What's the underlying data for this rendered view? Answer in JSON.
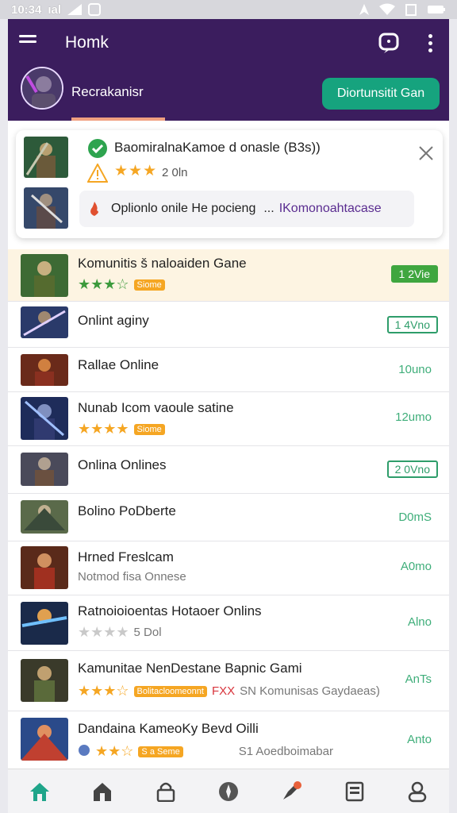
{
  "status_bar": {
    "time": "10:34",
    "carrier": "ıal"
  },
  "app_bar": {
    "title": "Homk",
    "profile_name": "Recrakanisr",
    "primary_button": "Diortunsitit Gan"
  },
  "notification": {
    "title": "BaomiralnaKamoe d onasle (B3s))",
    "meta": "2 0ln",
    "message": "Oplionlo onile He pocieng",
    "ellipsis": "...",
    "link": "IKomonoahtacase"
  },
  "games": [
    {
      "title": "Komunitis š naloaiden Gane",
      "stars": "★★★☆",
      "tag": "Siome",
      "badge": "1 2Vie"
    },
    {
      "title": "Onlint aginy",
      "badge": "1 4Vno"
    },
    {
      "title": "Rallae Online",
      "badge": "10uno"
    },
    {
      "title": "Nunab Icom vaoule satine",
      "stars": "★★★★",
      "tag": "Siome",
      "badge": "12umo"
    },
    {
      "title": "Onlina Onlines",
      "badge": "2 0Vno"
    },
    {
      "title": "Bolino PoDberte",
      "badge": "D0mS"
    },
    {
      "title": "Hrned Freslcam",
      "subtitle": "Notmod fisa Onnese",
      "badge": "A0mo"
    },
    {
      "title": "Ratnoioioentas Hotaoer Onlins",
      "stars": "★★★★",
      "meta": "5 Dol",
      "badge": "Alno"
    },
    {
      "title": "Kamunitae NenDestane Bapnic Gami",
      "stars": "★★★☆",
      "tag": "Bolitacloomeonnt",
      "fx": "FXX",
      "meta": "SN Komunisas Gaydaeas)",
      "badge": "AnTs"
    },
    {
      "title": "Dandaina KameoKy Bevd Oilli",
      "stars": "★★☆",
      "tag": "S a Seme",
      "meta": "S1 Aoedboimabar",
      "badge": "Anto"
    }
  ],
  "bottom_nav": [
    "home",
    "store",
    "lock",
    "compass",
    "rocket",
    "news",
    "profile"
  ],
  "colors": {
    "header": "#3b1d5e",
    "accent": "#16a37e",
    "star": "#f5a623",
    "badge": "#2e9d6a"
  }
}
